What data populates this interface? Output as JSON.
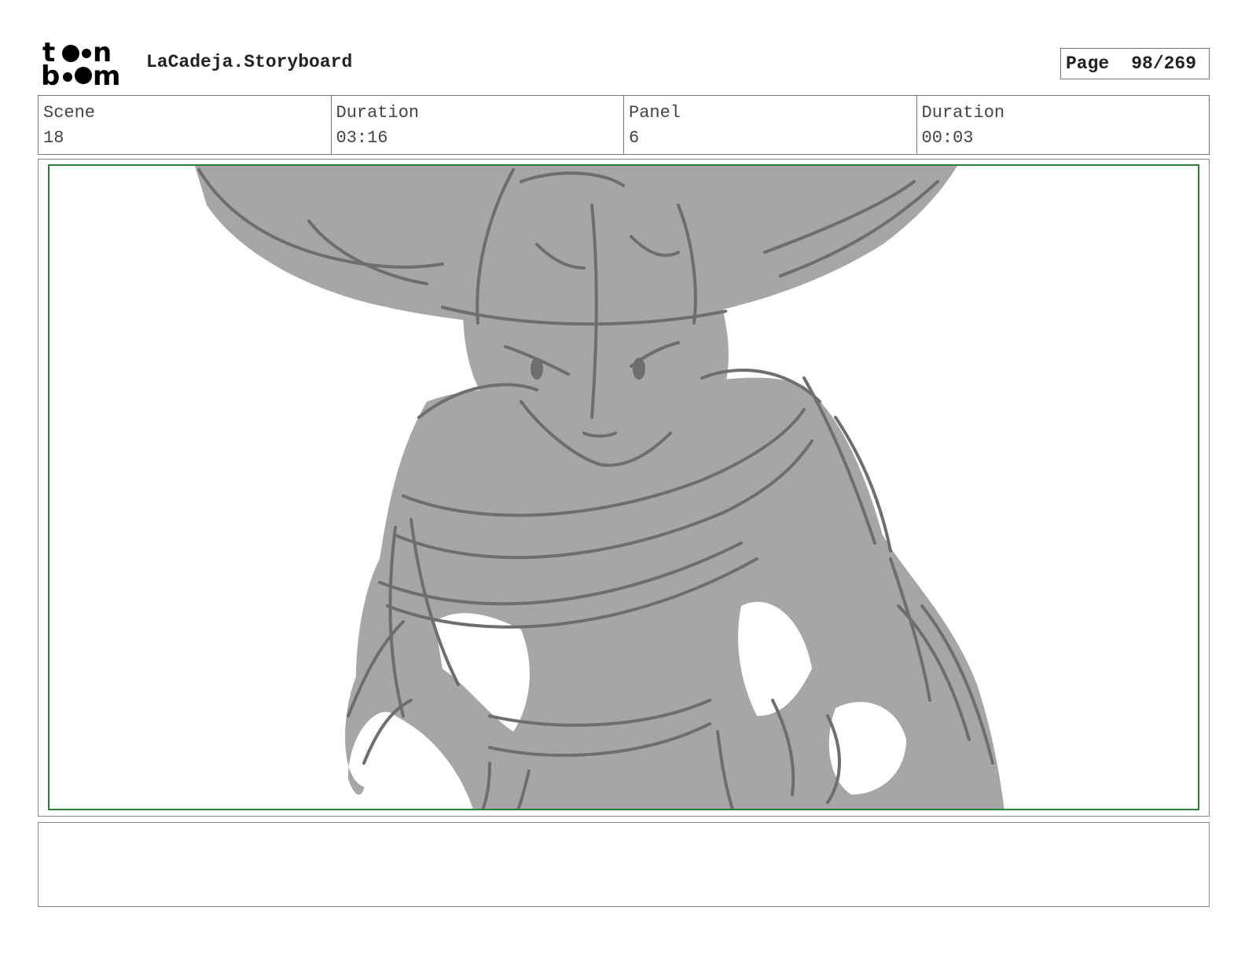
{
  "header": {
    "logo_alt": "toon boom",
    "title": "LaCadeja.Storyboard",
    "page_label": "Page",
    "page_number": "98/269"
  },
  "info": {
    "scene_label": "Scene",
    "scene_value": "18",
    "scene_duration_label": "Duration",
    "scene_duration_value": "03:16",
    "panel_label": "Panel",
    "panel_value": "6",
    "panel_duration_label": "Duration",
    "panel_duration_value": "00:03"
  },
  "panel": {
    "frame_color": "#2e7d32",
    "sketch_fill": "#a6a6a6",
    "sketch_stroke": "#6e6e6e"
  },
  "notes": {
    "text": ""
  }
}
